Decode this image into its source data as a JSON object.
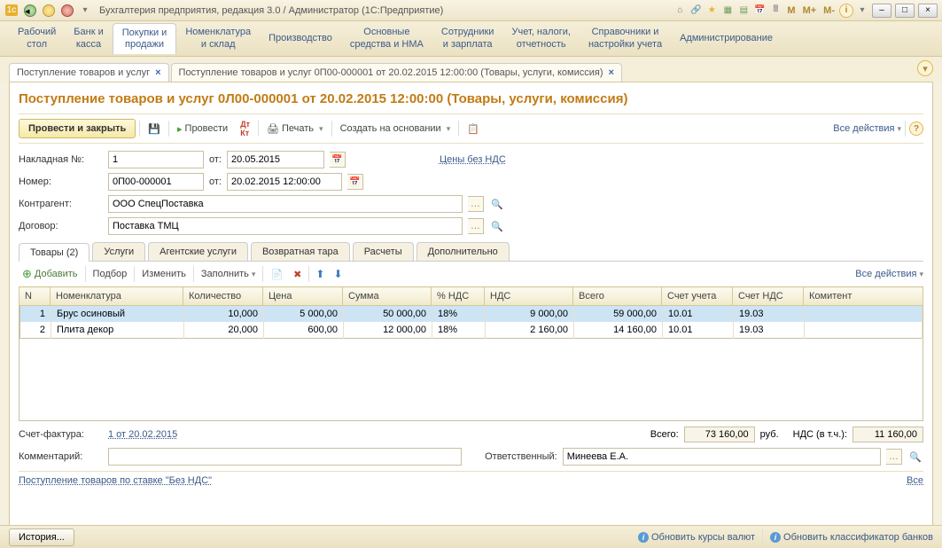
{
  "app": {
    "title": "Бухгалтерия предприятия, редакция 3.0 / Администратор  (1С:Предприятие)"
  },
  "mainmenu": {
    "items": [
      "Рабочий\nстол",
      "Банк и\nкасса",
      "Покупки и\nпродажи",
      "Номенклатура\nи склад",
      "Производство",
      "Основные\nсредства и НМА",
      "Сотрудники\nи зарплата",
      "Учет, налоги,\nотчетность",
      "Справочники и\nнастройки учета",
      "Администрирование"
    ],
    "active_index": 2
  },
  "tabs": {
    "items": [
      {
        "label": "Поступление товаров и услуг"
      },
      {
        "label": "Поступление товаров и услуг 0П00-000001 от 20.02.2015 12:00:00 (Товары, услуги, комиссия)"
      }
    ]
  },
  "doc": {
    "title": "Поступление товаров и услуг 0Л00-000001 от 20.02.2015 12:00:00 (Товары, услуги, комиссия)",
    "toolbar": {
      "post_close": "Провести и закрыть",
      "post": "Провести",
      "print": "Печать",
      "create_based": "Создать на основании",
      "all_actions": "Все действия"
    },
    "fields": {
      "invoice_label": "Накладная №:",
      "invoice_num": "1",
      "from_label": "от:",
      "invoice_date": "20.05.2015",
      "prices_link": "Цены без НДС",
      "number_label": "Номер:",
      "number": "0П00-000001",
      "datetime": "20.02.2015 12:00:00",
      "counterparty_label": "Контрагент:",
      "counterparty": "ООО СпецПоставка",
      "contract_label": "Договор:",
      "contract": "Поставка ТМЦ"
    },
    "inner_tabs": [
      "Товары (2)",
      "Услуги",
      "Агентские услуги",
      "Возвратная тара",
      "Расчеты",
      "Дополнительно"
    ],
    "sub_toolbar": {
      "add": "Добавить",
      "pick": "Подбор",
      "edit": "Изменить",
      "fill": "Заполнить",
      "all_actions": "Все действия"
    },
    "table": {
      "headers": [
        "N",
        "Номенклатура",
        "Количество",
        "Цена",
        "Сумма",
        "% НДС",
        "НДС",
        "Всего",
        "Счет учета",
        "Счет НДС",
        "Комитент"
      ],
      "rows": [
        {
          "n": "1",
          "nom": "Брус осиновый",
          "qty": "10,000",
          "price": "5 000,00",
          "sum": "50 000,00",
          "vat_rate": "18%",
          "vat": "9 000,00",
          "total": "59 000,00",
          "acc": "10.01",
          "vat_acc": "19.03",
          "committent": ""
        },
        {
          "n": "2",
          "nom": "Плита декор",
          "qty": "20,000",
          "price": "600,00",
          "sum": "12 000,00",
          "vat_rate": "18%",
          "vat": "2 160,00",
          "total": "14 160,00",
          "acc": "10.01",
          "vat_acc": "19.03",
          "committent": ""
        }
      ]
    },
    "footer": {
      "invoice_fact_label": "Счет-фактура:",
      "invoice_fact_link": "1 от 20.02.2015",
      "total_label": "Всего:",
      "total": "73 160,00",
      "currency": "руб.",
      "vat_incl_label": "НДС (в т.ч.):",
      "vat_incl": "11 160,00",
      "comment_label": "Комментарий:",
      "comment": "",
      "responsible_label": "Ответственный:",
      "responsible": "Минеева Е.А.",
      "bottom_link": "Поступление товаров по ставке \"Без НДС\"",
      "all_link": "Все"
    }
  },
  "statusbar": {
    "history": "История...",
    "update_rates": "Обновить курсы валют",
    "update_banks": "Обновить классификатор банков"
  },
  "memory_buttons": [
    "M",
    "M+",
    "M-"
  ]
}
